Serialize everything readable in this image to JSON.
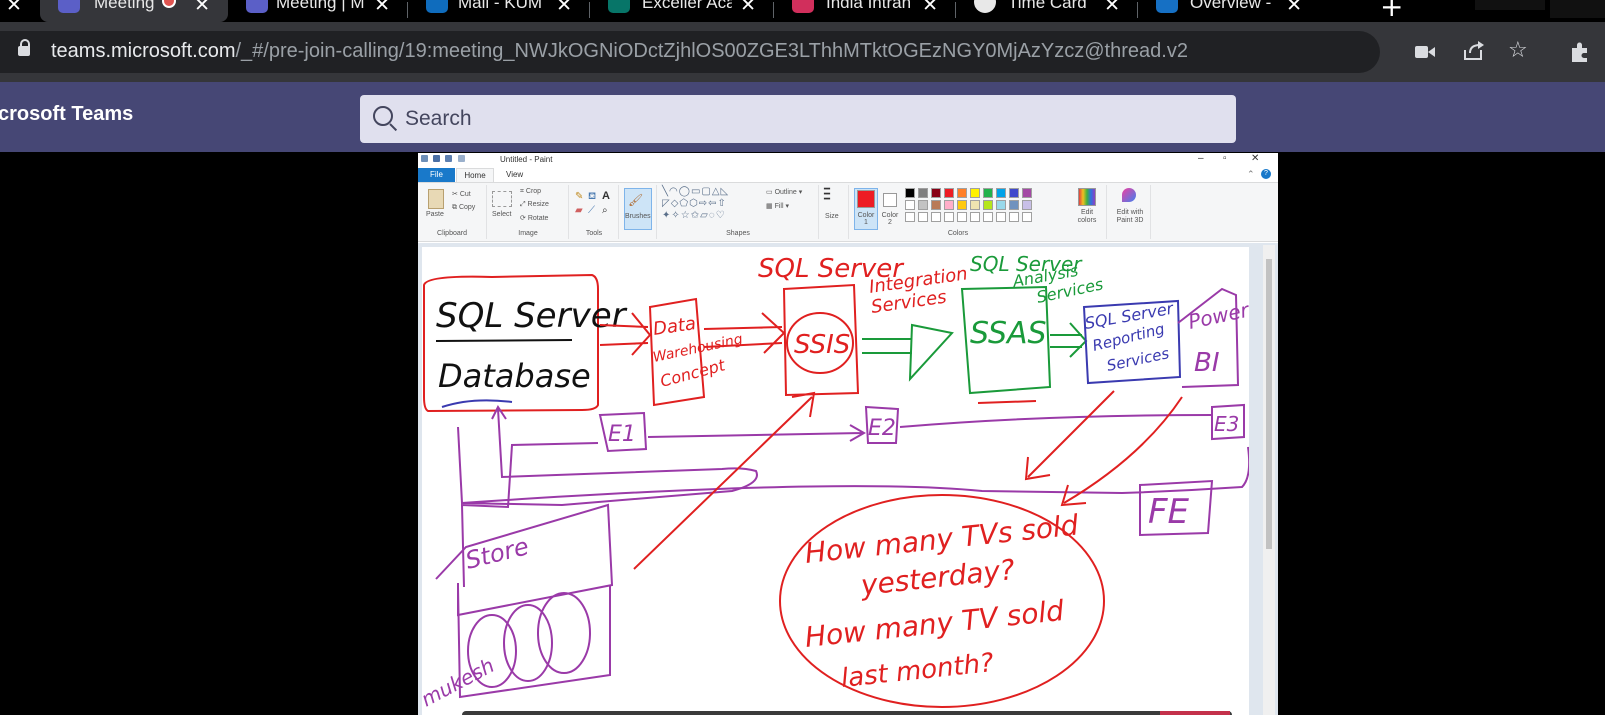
{
  "browser": {
    "tabs": [
      {
        "label": "Meeting",
        "active": true,
        "icon": "teams-icon",
        "recording": true
      },
      {
        "label": "Meeting | M",
        "active": false,
        "icon": "teams-icon"
      },
      {
        "label": "Mail - KUM",
        "active": false,
        "icon": "outlook-icon"
      },
      {
        "label": "Exceller Aca",
        "active": false,
        "icon": "forms-icon"
      },
      {
        "label": "India Intran",
        "active": false,
        "icon": "t-icon"
      },
      {
        "label": "Time Card",
        "active": false,
        "icon": "globe-icon"
      },
      {
        "label": "Overview -",
        "active": false,
        "icon": "sap-icon"
      }
    ],
    "url_host": "teams.microsoft.com",
    "url_path": "/_#/pre-join-calling/19:meeting_NWJkOGNiODctZjhlOS00ZGE3LThhMTktOGEzNGY0MjAzYzcz@thread.v2"
  },
  "teams": {
    "title": "crosoft Teams",
    "search_placeholder": "Search"
  },
  "paint": {
    "window_title": "Untitled - Paint",
    "tabs": [
      "File",
      "Home",
      "View"
    ],
    "ribbon": {
      "clipboard": {
        "paste": "Paste",
        "cut": "Cut",
        "copy": "Copy",
        "group": "Clipboard"
      },
      "image": {
        "select": "Select",
        "crop": "Crop",
        "resize": "Resize",
        "rotate": "Rotate",
        "group": "Image"
      },
      "tools": {
        "group": "Tools"
      },
      "brushes": "Brushes",
      "shapes": {
        "outline": "Outline",
        "fill": "Fill",
        "group": "Shapes"
      },
      "size": "Size",
      "color1": "Color 1",
      "color2": "Color 2",
      "colors_group": "Colors",
      "edit_colors": "Edit colors",
      "edit_paint3d": "Edit with Paint 3D"
    },
    "palette": [
      "#000000",
      "#7f7f7f",
      "#880015",
      "#ed1c24",
      "#ff7f27",
      "#fff200",
      "#22b14c",
      "#00a2e8",
      "#3f48cc",
      "#a349a4",
      "#ffffff",
      "#c3c3c3",
      "#b97a57",
      "#ffaec9",
      "#ffc90e",
      "#efe4b0",
      "#b5e61d",
      "#99d9ea",
      "#7092be",
      "#c8bfe7"
    ],
    "drawing": {
      "sql_server": "SQL Server",
      "database": "Database",
      "data_warehousing": [
        "Data",
        "Warehousing",
        "Concept"
      ],
      "sql_server_top": "SQL Server",
      "integration_services": [
        "Integration",
        "Services"
      ],
      "ssis": "SSIS",
      "ssas_title": [
        "SQL Server",
        "Analysis",
        "Services"
      ],
      "ssas": "SSAS",
      "reporting": [
        "SQL Server",
        "Reporting",
        "Services"
      ],
      "power_bi": [
        "Power",
        "BI"
      ],
      "e1": "E1",
      "e2": "E2",
      "e3": "E3",
      "fe": "FE",
      "store": "Store",
      "question1": [
        "How many TVs sold",
        "yesterday?"
      ],
      "question2": [
        "How many TV sold",
        "last month?"
      ],
      "mukesh": "mukesh"
    }
  }
}
